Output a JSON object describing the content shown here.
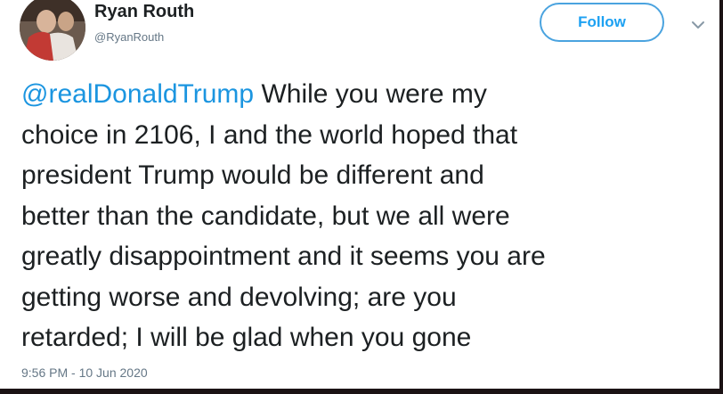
{
  "user": {
    "name": "Ryan Routh",
    "handle": "@RyanRouth"
  },
  "header": {
    "follow_label": "Follow",
    "more_icon": "chevron-down-icon"
  },
  "tweet": {
    "mention": "@realDonaldTrump",
    "line1_rest": " While you were my",
    "lines": [
      "choice in 2106, I and the world hoped that",
      "president Trump would be different and",
      "better than the candidate, but we all were",
      "greatly disappointment and it seems you are",
      "getting worse and devolving; are you",
      "retarded; I will be glad when you gone"
    ],
    "timestamp": "9:56 PM - 10 Jun 2020"
  },
  "colors": {
    "link": "#1b95e0",
    "follow_border": "#4aa3df",
    "secondary_text": "#657786",
    "frame": "#1b1214"
  }
}
